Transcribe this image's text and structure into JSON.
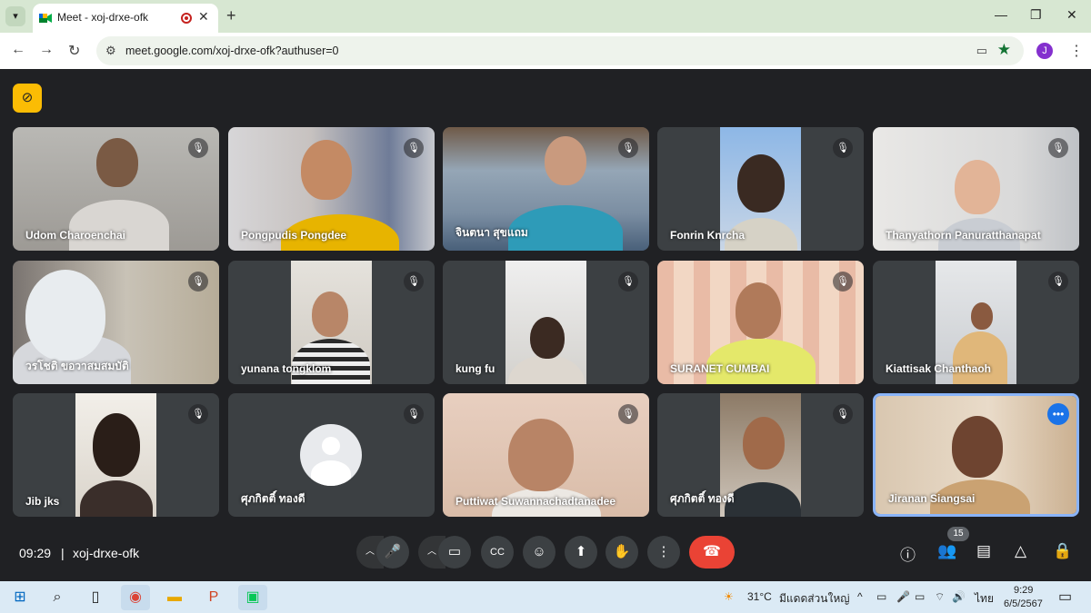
{
  "browser": {
    "tab_title": "Meet - xoj-drxe-ofk",
    "url": "meet.google.com/xoj-drxe-ofk?authuser=0",
    "profile_initial": "J"
  },
  "meeting": {
    "time": "09:29",
    "separator": "|",
    "code": "xoj-drxe-ofk",
    "people_count": "15"
  },
  "participants": [
    {
      "name": "Udom Charoenchai",
      "muted": true
    },
    {
      "name": "Pongpudis Pongdee",
      "muted": true
    },
    {
      "name": "จินตนา สุขแถม",
      "muted": true
    },
    {
      "name": "Fonrin Knrcha",
      "muted": true
    },
    {
      "name": "Thanyathorn Panuratthanapat",
      "muted": true
    },
    {
      "name": "วรโชติ ขอวาสมสมบัติ",
      "muted": true
    },
    {
      "name": "yunana tongklom",
      "muted": true
    },
    {
      "name": "kung fu",
      "muted": true
    },
    {
      "name": "SURANET CUMBAI",
      "muted": true
    },
    {
      "name": "Kiattisak Chanthaoh",
      "muted": true
    },
    {
      "name": "Jib jks",
      "muted": true
    },
    {
      "name": "ศุภกิตติ์ ทองดี",
      "muted": true
    },
    {
      "name": "Puttiwat Suwannachadtanadee",
      "muted": true
    },
    {
      "name": "ศุภกิตติ์ ทองดี",
      "muted": true
    },
    {
      "name": "Jiranan Siangsai",
      "muted": false
    }
  ],
  "taskbar": {
    "temperature": "31°C",
    "weather": "มีแดดส่วนใหญ่",
    "language": "ไทย",
    "time": "9:29",
    "date": "6/5/2567"
  },
  "colors": {
    "meet_bg": "#202124",
    "end_call": "#ea4335",
    "accent": "#8ab4f8",
    "indicator": "#fbbc04"
  }
}
